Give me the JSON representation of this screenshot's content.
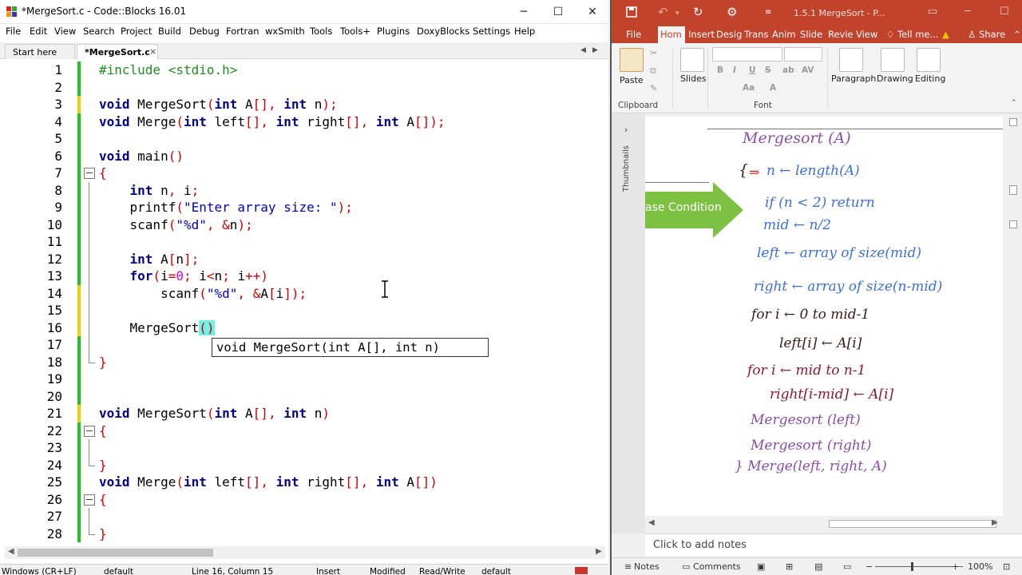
{
  "codeblocks": {
    "title": "*MergeSort.c - Code::Blocks 16.01",
    "window_controls": [
      "─",
      "☐",
      "✕"
    ],
    "menu": [
      "File",
      "Edit",
      "View",
      "Search",
      "Project",
      "Build",
      "Debug",
      "Fortran",
      "wxSmith",
      "Tools",
      "Tools+",
      "Plugins",
      "DoxyBlocks",
      "Settings",
      "Help"
    ],
    "tabs": {
      "start": "Start here",
      "active": "*MergeSort.c",
      "close": "×"
    },
    "line_numbers": [
      "1",
      "2",
      "3",
      "4",
      "5",
      "6",
      "7",
      "8",
      "9",
      "10",
      "11",
      "12",
      "13",
      "14",
      "15",
      "16",
      "17",
      "18",
      "19",
      "20",
      "21",
      "22",
      "23",
      "24",
      "25",
      "26",
      "27",
      "28"
    ],
    "code": {
      "l1": "#include <stdio.h>",
      "l3a": "void",
      "l3b": " MergeSort",
      "l3c": "(",
      "l3d": "int",
      "l3e": " A",
      "l3f": "[],",
      "l3g": " ",
      "l3h": "int",
      "l3i": " n",
      "l3j": ");",
      "l4a": "void",
      "l4b": " Merge",
      "l4c": "(",
      "l4d": "int",
      "l4e": " left",
      "l4f": "[],",
      "l4g": " ",
      "l4h": "int",
      "l4i": " right",
      "l4j": "[],",
      "l4k": " ",
      "l4l": "int",
      "l4m": " A",
      "l4n": "[]);",
      "l6a": "void",
      "l6b": " main",
      "l6c": "()",
      "l7": "{",
      "l8a": "    ",
      "l8b": "int",
      "l8c": " n",
      "l8d": ",",
      "l8e": " i",
      "l8f": ";",
      "l9a": "    printf",
      "l9b": "(",
      "l9c": "\"Enter array size: \"",
      "l9d": ");",
      "l10a": "    scanf",
      "l10b": "(",
      "l10c": "\"%d\"",
      "l10d": ",",
      "l10e": " ",
      "l10f": "&",
      "l10g": "n",
      "l10h": ");",
      "l12a": "    ",
      "l12b": "int",
      "l12c": " A",
      "l12d": "[",
      "l12e": "n",
      "l12f": "];",
      "l13a": "    ",
      "l13b": "for",
      "l13c": "(",
      "l13d": "i",
      "l13e": "=",
      "l13f": "0",
      "l13g": ";",
      "l13h": " i",
      "l13i": "<",
      "l13j": "n",
      "l13k": ";",
      "l13l": " i",
      "l13m": "++)",
      "l14a": "        scanf",
      "l14b": "(",
      "l14c": "\"%d\"",
      "l14d": ",",
      "l14e": " ",
      "l14f": "&",
      "l14g": "A",
      "l14h": "[",
      "l14i": "i",
      "l14j": "]);",
      "l16a": "    MergeSort",
      "l16b": "()",
      "l18": "}",
      "l21a": "void",
      "l21b": " MergeSort",
      "l21c": "(",
      "l21d": "int",
      "l21e": " A",
      "l21f": "[],",
      "l21g": " ",
      "l21h": "int",
      "l21i": " n",
      "l21j": ")",
      "l22": "{",
      "l24": "}",
      "l25a": "void",
      "l25b": " Merge",
      "l25c": "(",
      "l25d": "int",
      "l25e": " left",
      "l25f": "[],",
      "l25g": " ",
      "l25h": "int",
      "l25i": " right",
      "l25j": "[],",
      "l25k": " ",
      "l25l": "int",
      "l25m": " A",
      "l25n": "[])",
      "l26": "{",
      "l28": "}"
    },
    "tooltip": "void MergeSort(int A[], int n)",
    "status": {
      "eol": "Windows (CR+LF)",
      "encoding": "default",
      "position": "Line 16, Column 15",
      "mode": "Insert",
      "modified": "Modified",
      "access": "Read/Write",
      "lang": "default"
    },
    "colors": {
      "keyword": "#00008b",
      "preprocessor": "#228b22",
      "punct": "#d00000",
      "string": "#0000cd",
      "number": "#e000e0",
      "brace_highlight": "#6ff0e8",
      "change_green": "#22c322",
      "change_yellow": "#f5d000"
    }
  },
  "powerpoint": {
    "doc_title": "1.5.1 MergeSort - P...",
    "qat_icons": [
      "save-icon",
      "undo-icon",
      "redo-icon",
      "present-icon"
    ],
    "tabs": [
      "File",
      "Hom",
      "Insert",
      "Desig",
      "Trans",
      "Anim",
      "Slide",
      "Revie",
      "View"
    ],
    "tell_me": "Tell me...",
    "share": "Share",
    "ribbon": {
      "paste": "Paste",
      "slides": "Slides",
      "paragraph": "Paragraph",
      "drawing": "Drawing",
      "editing": "Editing",
      "clipboard": "Clipboard",
      "font": "Font",
      "font_buttons": [
        "B",
        "I",
        "U",
        "S",
        "ab",
        "AV",
        "Aa",
        "A"
      ]
    },
    "thumbnails_label": "Thumbnails",
    "slide": {
      "arrow_text": "ase Condition",
      "hw": {
        "h1": "Mergesort (A)",
        "h2a": "{",
        "h2b": "⇒",
        "h2c": "n ← length(A)",
        "h3": "if (n < 2) return",
        "h4": "mid ← n/2",
        "h5": "left ← array of size(mid)",
        "h6": "right ← array of size(n-mid)",
        "h7": "for i ← 0 to mid-1",
        "h8": "left[i] ← A[i]",
        "h9": "for i ← mid to n-1",
        "h10": "right[i-mid] ← A[i]",
        "h11": "Mergesort (left)",
        "h12": "Mergesort (right)",
        "h13": "} Merge(left, right, A)"
      }
    },
    "notes_placeholder": "Click to add notes",
    "status": {
      "notes": "Notes",
      "comments": "Comments",
      "zoom": "100%"
    },
    "colors": {
      "accent": "#c2432b",
      "arrow_green": "#7cc142"
    }
  }
}
